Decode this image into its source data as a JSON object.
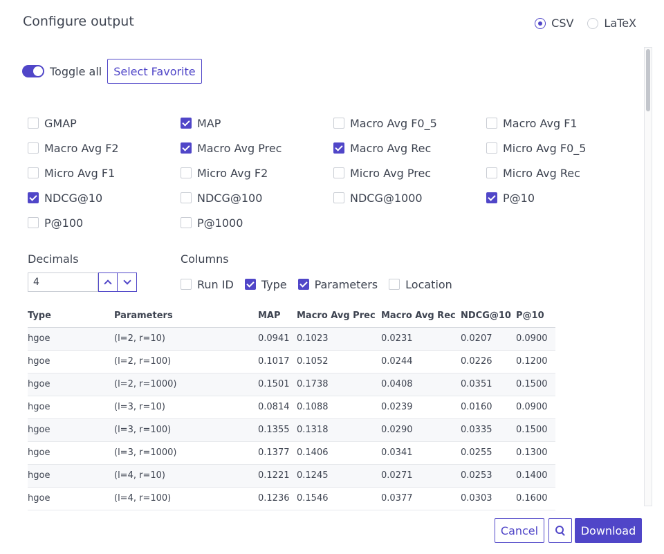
{
  "title": "Configure output",
  "format": {
    "options": [
      {
        "label": "CSV",
        "selected": true
      },
      {
        "label": "LaTeX",
        "selected": false
      }
    ]
  },
  "toggle_all": {
    "label": "Toggle all",
    "on": true
  },
  "select_favorite_label": "Select Favorite",
  "metrics": [
    {
      "label": "GMAP",
      "checked": false
    },
    {
      "label": "MAP",
      "checked": true
    },
    {
      "label": "Macro Avg F0_5",
      "checked": false
    },
    {
      "label": "Macro Avg F1",
      "checked": false
    },
    {
      "label": "Macro Avg F2",
      "checked": false
    },
    {
      "label": "Macro Avg Prec",
      "checked": true
    },
    {
      "label": "Macro Avg Rec",
      "checked": true
    },
    {
      "label": "Micro Avg F0_5",
      "checked": false
    },
    {
      "label": "Micro Avg F1",
      "checked": false
    },
    {
      "label": "Micro Avg F2",
      "checked": false
    },
    {
      "label": "Micro Avg Prec",
      "checked": false
    },
    {
      "label": "Micro Avg Rec",
      "checked": false
    },
    {
      "label": "NDCG@10",
      "checked": true
    },
    {
      "label": "NDCG@100",
      "checked": false
    },
    {
      "label": "NDCG@1000",
      "checked": false
    },
    {
      "label": "P@10",
      "checked": true
    },
    {
      "label": "P@100",
      "checked": false
    },
    {
      "label": "P@1000",
      "checked": false
    }
  ],
  "decimals": {
    "label": "Decimals",
    "value": "4"
  },
  "columns": {
    "label": "Columns",
    "options": [
      {
        "label": "Run ID",
        "checked": false
      },
      {
        "label": "Type",
        "checked": true
      },
      {
        "label": "Parameters",
        "checked": true
      },
      {
        "label": "Location",
        "checked": false
      }
    ]
  },
  "table": {
    "headers": [
      "Type",
      "Parameters",
      "MAP",
      "Macro Avg Prec",
      "Macro Avg Rec",
      "NDCG@10",
      "P@10"
    ],
    "rows": [
      [
        "hgoe",
        "(l=2, r=10)",
        "0.0941",
        "0.1023",
        "0.0231",
        "0.0207",
        "0.0900"
      ],
      [
        "hgoe",
        "(l=2, r=100)",
        "0.1017",
        "0.1052",
        "0.0244",
        "0.0226",
        "0.1200"
      ],
      [
        "hgoe",
        "(l=2, r=1000)",
        "0.1501",
        "0.1738",
        "0.0408",
        "0.0351",
        "0.1500"
      ],
      [
        "hgoe",
        "(l=3, r=10)",
        "0.0814",
        "0.1088",
        "0.0239",
        "0.0160",
        "0.0900"
      ],
      [
        "hgoe",
        "(l=3, r=100)",
        "0.1355",
        "0.1318",
        "0.0290",
        "0.0335",
        "0.1500"
      ],
      [
        "hgoe",
        "(l=3, r=1000)",
        "0.1377",
        "0.1406",
        "0.0341",
        "0.0255",
        "0.1300"
      ],
      [
        "hgoe",
        "(l=4, r=10)",
        "0.1221",
        "0.1245",
        "0.0271",
        "0.0253",
        "0.1400"
      ],
      [
        "hgoe",
        "(l=4, r=100)",
        "0.1236",
        "0.1546",
        "0.0377",
        "0.0303",
        "0.1600"
      ]
    ]
  },
  "footer": {
    "cancel_label": "Cancel",
    "search_icon": "search-icon",
    "download_label": "Download"
  },
  "colors": {
    "accent": "#5046c8",
    "text": "#3d4350",
    "stripe": "#f7f8fa"
  }
}
